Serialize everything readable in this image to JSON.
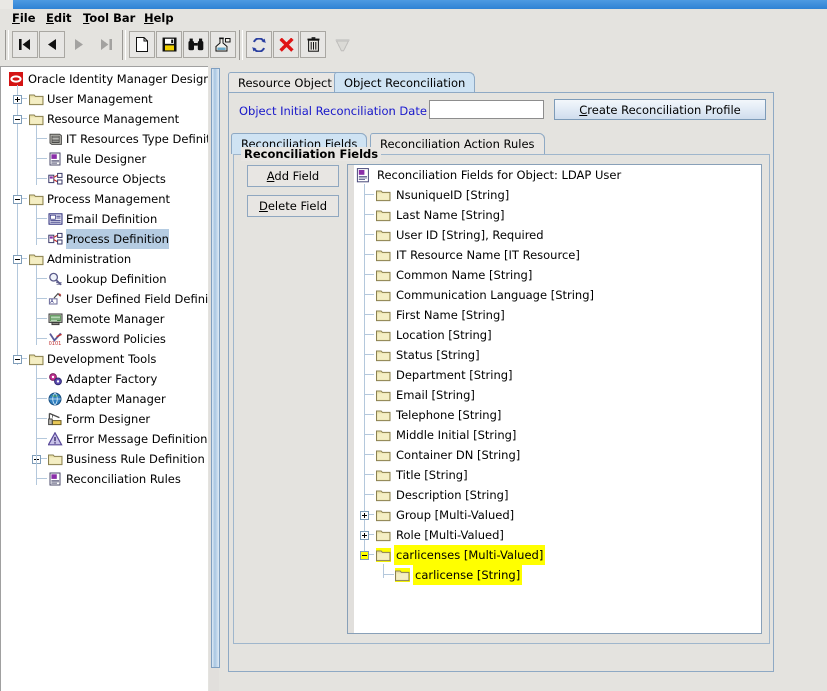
{
  "window": {
    "title_bar_color": "#3a8ddb"
  },
  "menu": {
    "items": [
      {
        "label": "File",
        "mnemonic": "F"
      },
      {
        "label": "Edit",
        "mnemonic": "E"
      },
      {
        "label": "Tool Bar",
        "mnemonic": "T"
      },
      {
        "label": "Help",
        "mnemonic": "H"
      }
    ]
  },
  "toolbar": {
    "buttons": [
      {
        "name": "first-record-icon",
        "enabled": true
      },
      {
        "name": "previous-record-icon",
        "enabled": true
      },
      {
        "name": "next-record-icon",
        "enabled": false
      },
      {
        "name": "last-record-icon",
        "enabled": false
      },
      {
        "name": "new-document-icon",
        "enabled": true
      },
      {
        "name": "save-icon",
        "enabled": true
      },
      {
        "name": "find-binoculars-icon",
        "enabled": true
      },
      {
        "name": "assign-icon",
        "enabled": true
      },
      {
        "name": "refresh-icon",
        "enabled": true
      },
      {
        "name": "delete-x-icon",
        "enabled": true
      },
      {
        "name": "trash-icon",
        "enabled": true
      },
      {
        "name": "empty-trash-icon",
        "enabled": false
      }
    ]
  },
  "sidebar": {
    "root": {
      "label": "Oracle Identity Manager Design Co",
      "icon": "oracle-logo-icon"
    },
    "items": [
      {
        "label": "User Management",
        "level": 1,
        "toggle": "plus",
        "icon": "folder-icon",
        "selected": false
      },
      {
        "label": "Resource Management",
        "level": 1,
        "toggle": "minus",
        "icon": "folder-icon",
        "selected": false
      },
      {
        "label": "IT Resources Type Definiti",
        "level": 2,
        "toggle": "none",
        "icon": "server-icon",
        "selected": false
      },
      {
        "label": "Rule Designer",
        "level": 2,
        "toggle": "none",
        "icon": "rule-icon",
        "selected": false
      },
      {
        "label": "Resource Objects",
        "level": 2,
        "toggle": "none",
        "icon": "object-icon",
        "selected": false
      },
      {
        "label": "Process Management",
        "level": 1,
        "toggle": "minus",
        "icon": "folder-icon",
        "selected": false
      },
      {
        "label": "Email Definition",
        "level": 2,
        "toggle": "none",
        "icon": "email-icon",
        "selected": false
      },
      {
        "label": "Process Definition",
        "level": 2,
        "toggle": "none",
        "icon": "object-icon",
        "selected": true
      },
      {
        "label": "Administration",
        "level": 1,
        "toggle": "minus",
        "icon": "folder-icon",
        "selected": false
      },
      {
        "label": "Lookup Definition",
        "level": 2,
        "toggle": "none",
        "icon": "magnifier-icon",
        "selected": false
      },
      {
        "label": "User Defined Field Definiti",
        "level": 2,
        "toggle": "none",
        "icon": "udf-icon",
        "selected": false
      },
      {
        "label": "Remote Manager",
        "level": 2,
        "toggle": "none",
        "icon": "monitor-icon",
        "selected": false
      },
      {
        "label": "Password Policies",
        "level": 2,
        "toggle": "none",
        "icon": "password-icon",
        "selected": false
      },
      {
        "label": "Development Tools",
        "level": 1,
        "toggle": "minus",
        "icon": "folder-icon",
        "selected": false
      },
      {
        "label": "Adapter Factory",
        "level": 2,
        "toggle": "none",
        "icon": "gears-icon",
        "selected": false
      },
      {
        "label": "Adapter Manager",
        "level": 2,
        "toggle": "none",
        "icon": "globe-icon",
        "selected": false
      },
      {
        "label": "Form Designer",
        "level": 2,
        "toggle": "none",
        "icon": "crane-icon",
        "selected": false
      },
      {
        "label": "Error Message Definition",
        "level": 2,
        "toggle": "none",
        "icon": "warning-icon",
        "selected": false
      },
      {
        "label": "Business Rule Definition",
        "level": 2,
        "toggle": "plus",
        "icon": "folder-icon",
        "selected": false
      },
      {
        "label": "Reconciliation Rules",
        "level": 2,
        "toggle": "none",
        "icon": "rule-icon",
        "selected": false
      }
    ]
  },
  "main": {
    "outer_tabs": [
      {
        "label": "Resource Object",
        "active": false
      },
      {
        "label": "Object Reconciliation",
        "active": true
      }
    ],
    "recon_date": {
      "label": "Object Initial Reconciliation Date",
      "value": "",
      "placeholder": ""
    },
    "create_profile_button": {
      "label": "Create Reconciliation Profile",
      "mnemonic": "C"
    },
    "inner_tabs": [
      {
        "label": "Reconciliation Fields",
        "active": true
      },
      {
        "label": "Reconciliation Action Rules",
        "active": false
      }
    ],
    "group_title": "Reconciliation Fields",
    "add_field_button": {
      "label": "Add Field",
      "mnemonic": "A"
    },
    "delete_field_button": {
      "label": "Delete Field",
      "mnemonic": "D"
    },
    "field_tree": {
      "root": {
        "label": "Reconciliation Fields for Object: LDAP User",
        "icon": "recon-root-icon"
      },
      "nodes": [
        {
          "label": "NsuniqueID [String]",
          "level": 1,
          "toggle": "none",
          "highlight": false
        },
        {
          "label": "Last Name [String]",
          "level": 1,
          "toggle": "none",
          "highlight": false
        },
        {
          "label": "User ID [String], Required",
          "level": 1,
          "toggle": "none",
          "highlight": false
        },
        {
          "label": "IT Resource Name [IT Resource]",
          "level": 1,
          "toggle": "none",
          "highlight": false
        },
        {
          "label": "Common Name [String]",
          "level": 1,
          "toggle": "none",
          "highlight": false
        },
        {
          "label": "Communication Language [String]",
          "level": 1,
          "toggle": "none",
          "highlight": false
        },
        {
          "label": "First Name [String]",
          "level": 1,
          "toggle": "none",
          "highlight": false
        },
        {
          "label": "Location [String]",
          "level": 1,
          "toggle": "none",
          "highlight": false
        },
        {
          "label": "Status [String]",
          "level": 1,
          "toggle": "none",
          "highlight": false
        },
        {
          "label": "Department [String]",
          "level": 1,
          "toggle": "none",
          "highlight": false
        },
        {
          "label": "Email [String]",
          "level": 1,
          "toggle": "none",
          "highlight": false
        },
        {
          "label": "Telephone [String]",
          "level": 1,
          "toggle": "none",
          "highlight": false
        },
        {
          "label": "Middle Initial [String]",
          "level": 1,
          "toggle": "none",
          "highlight": false
        },
        {
          "label": "Container DN [String]",
          "level": 1,
          "toggle": "none",
          "highlight": false
        },
        {
          "label": "Title [String]",
          "level": 1,
          "toggle": "none",
          "highlight": false
        },
        {
          "label": "Description [String]",
          "level": 1,
          "toggle": "none",
          "highlight": false
        },
        {
          "label": "Group [Multi-Valued]",
          "level": 1,
          "toggle": "plus",
          "highlight": false
        },
        {
          "label": "Role [Multi-Valued]",
          "level": 1,
          "toggle": "plus",
          "highlight": false
        },
        {
          "label": "carlicenses [Multi-Valued]",
          "level": 1,
          "toggle": "minus",
          "highlight": true
        },
        {
          "label": "carlicense [String]",
          "level": 2,
          "toggle": "none",
          "highlight": true
        }
      ]
    }
  },
  "colors": {
    "highlight_yellow": "#ffff00",
    "selection_blue": "#b5cce2",
    "tab_active": "#cfe3f3",
    "label_blue": "#1717c9"
  }
}
